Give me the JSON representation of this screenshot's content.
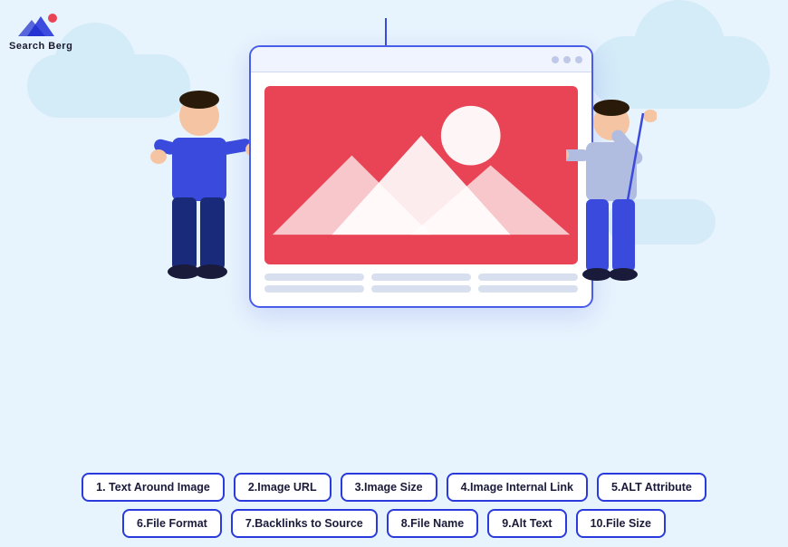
{
  "logo": {
    "text": "Search Berg",
    "alt": "Search Berg Logo"
  },
  "tags": {
    "row1": [
      "1. Text Around Image",
      "2.Image URL",
      "3.Image Size",
      "4.Image Internal Link",
      "5.ALT Attribute"
    ],
    "row2": [
      "6.File Format",
      "7.Backlinks to Source",
      "8.File Name",
      "9.Alt Text",
      "10.File Size"
    ]
  }
}
